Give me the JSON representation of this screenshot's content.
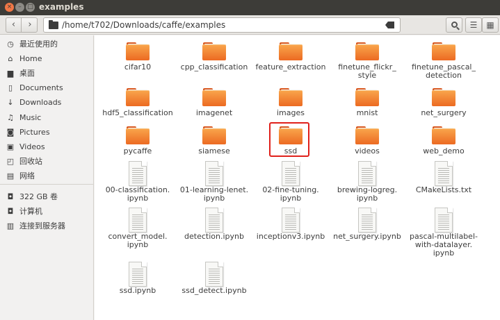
{
  "window": {
    "title": "examples"
  },
  "toolbar": {
    "path": "/home/t702/Downloads/caffe/examples"
  },
  "sidebar": {
    "items": [
      {
        "label": "最近使用的",
        "icon": "clock-icon"
      },
      {
        "label": "Home",
        "icon": "home-icon"
      },
      {
        "label": "桌面",
        "icon": "folder-icon"
      },
      {
        "label": "Documents",
        "icon": "document-icon"
      },
      {
        "label": "Downloads",
        "icon": "download-icon"
      },
      {
        "label": "Music",
        "icon": "music-icon"
      },
      {
        "label": "Pictures",
        "icon": "camera-icon"
      },
      {
        "label": "Videos",
        "icon": "video-icon"
      },
      {
        "label": "回收站",
        "icon": "trash-icon"
      },
      {
        "label": "网络",
        "icon": "network-icon"
      }
    ],
    "devices": [
      {
        "label": "322 GB 卷",
        "icon": "drive-icon"
      },
      {
        "label": "计算机",
        "icon": "computer-icon"
      },
      {
        "label": "连接到服务器",
        "icon": "server-icon"
      }
    ]
  },
  "files": [
    {
      "name": "cifar10",
      "type": "folder"
    },
    {
      "name": "cpp_classification",
      "type": "folder"
    },
    {
      "name": "feature_extraction",
      "type": "folder"
    },
    {
      "name": "finetune_flickr_",
      "name2": "style",
      "type": "folder"
    },
    {
      "name": "finetune_pascal_",
      "name2": "detection",
      "type": "folder"
    },
    {
      "name": "hdf5_classification",
      "type": "folder"
    },
    {
      "name": "imagenet",
      "type": "folder"
    },
    {
      "name": "images",
      "type": "folder"
    },
    {
      "name": "mnist",
      "type": "folder"
    },
    {
      "name": "net_surgery",
      "type": "folder"
    },
    {
      "name": "pycaffe",
      "type": "folder"
    },
    {
      "name": "siamese",
      "type": "folder"
    },
    {
      "name": "ssd",
      "type": "folder",
      "highlight": true
    },
    {
      "name": "videos",
      "type": "folder"
    },
    {
      "name": "web_demo",
      "type": "folder"
    },
    {
      "name": "00-classification.",
      "name2": "ipynb",
      "type": "doc"
    },
    {
      "name": "01-learning-lenet.",
      "name2": "ipynb",
      "type": "doc"
    },
    {
      "name": "02-fine-tuning.",
      "name2": "ipynb",
      "type": "doc"
    },
    {
      "name": "brewing-logreg.",
      "name2": "ipynb",
      "type": "doc"
    },
    {
      "name": "CMakeLists.txt",
      "type": "doc"
    },
    {
      "name": "convert_model.",
      "name2": "ipynb",
      "type": "doc"
    },
    {
      "name": "detection.ipynb",
      "type": "doc"
    },
    {
      "name": "inceptionv3.ipynb",
      "type": "doc"
    },
    {
      "name": "net_surgery.ipynb",
      "type": "doc"
    },
    {
      "name": "pascal-multilabel-",
      "name2": "with-datalayer.",
      "name3": "ipynb",
      "type": "doc"
    },
    {
      "name": "ssd.ipynb",
      "type": "doc"
    },
    {
      "name": "ssd_detect.ipynb",
      "type": "doc"
    }
  ]
}
